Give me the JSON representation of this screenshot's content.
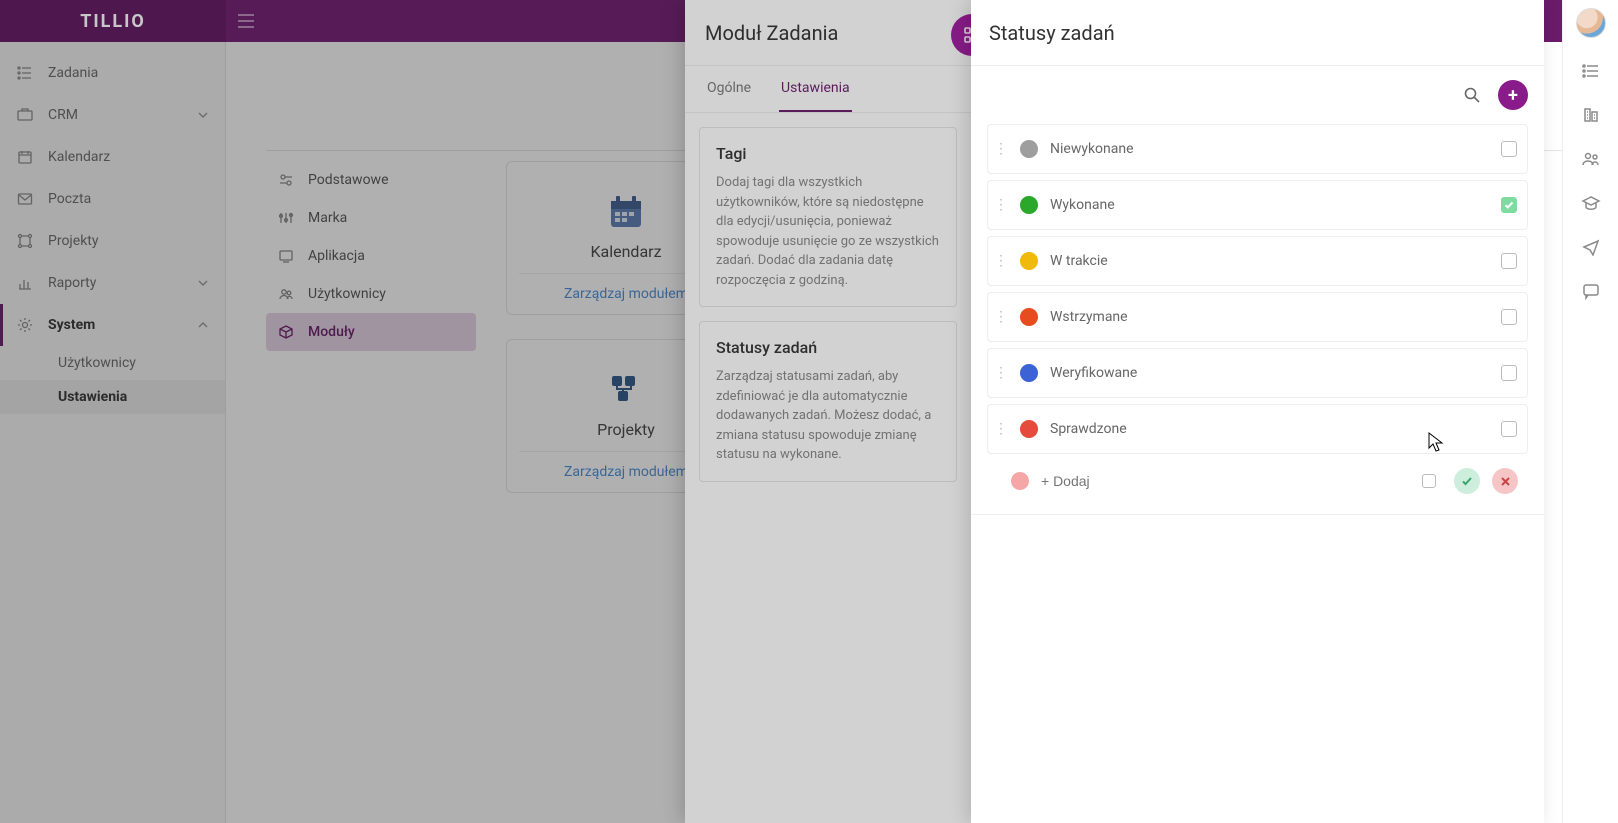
{
  "brand": "TILLIO",
  "sidebar": {
    "items": [
      {
        "label": "Zadania"
      },
      {
        "label": "CRM",
        "expandable": true
      },
      {
        "label": "Kalendarz"
      },
      {
        "label": "Poczta"
      },
      {
        "label": "Projekty"
      },
      {
        "label": "Raporty",
        "expandable": true
      },
      {
        "label": "System",
        "expandable": true,
        "expanded": true
      }
    ],
    "system_children": [
      {
        "label": "Użytkownicy"
      },
      {
        "label": "Ustawienia"
      }
    ]
  },
  "settings": {
    "title": "Ustawienia",
    "top_tabs": [
      "Podstawowe"
    ],
    "nav": [
      {
        "label": "Podstawowe"
      },
      {
        "label": "Marka"
      },
      {
        "label": "Aplikacja"
      },
      {
        "label": "Użytkownicy"
      },
      {
        "label": "Moduły"
      }
    ],
    "cards": [
      {
        "title": "Kalendarz",
        "link": "Zarządzaj modułem"
      },
      {
        "title": "Projekty",
        "link": "Zarządzaj modułem"
      }
    ]
  },
  "module_panel": {
    "title": "Moduł Zadania",
    "tabs": [
      "Ogólne",
      "Ustawienia"
    ],
    "active_tab": "Ustawienia",
    "cards": [
      {
        "title": "Tagi",
        "desc": "Dodaj tagi dla wszystkich użytkowników, które są niedostępne dla edycji/usunięcia, ponieważ spowoduje usunięcie go ze wszystkich zadań. Dodać dla zadania datę rozpoczęcia z godziną."
      },
      {
        "title": "Statusy zadań",
        "desc": "Zarządzaj statusami zadań, aby zdefiniować je dla automatycznie dodawanych zadań. Możesz dodać, a zmiana statusu spowoduje zmianę statusu na wykonane."
      }
    ]
  },
  "status_panel": {
    "title": "Statusy zadań",
    "statuses": [
      {
        "label": "Niewykonane",
        "color": "#9e9e9e",
        "checked": false
      },
      {
        "label": "Wykonane",
        "color": "#2aa82a",
        "checked": true
      },
      {
        "label": "W trakcie",
        "color": "#f0b90b",
        "checked": false
      },
      {
        "label": "Wstrzymane",
        "color": "#e74c1f",
        "checked": false
      },
      {
        "label": "Weryfikowane",
        "color": "#3b63d6",
        "checked": false
      },
      {
        "label": "Sprawdzone",
        "color": "#e44b3c",
        "checked": false
      }
    ],
    "add_placeholder": "+ Dodaj"
  },
  "colors": {
    "brand": "#6a1b6a"
  }
}
